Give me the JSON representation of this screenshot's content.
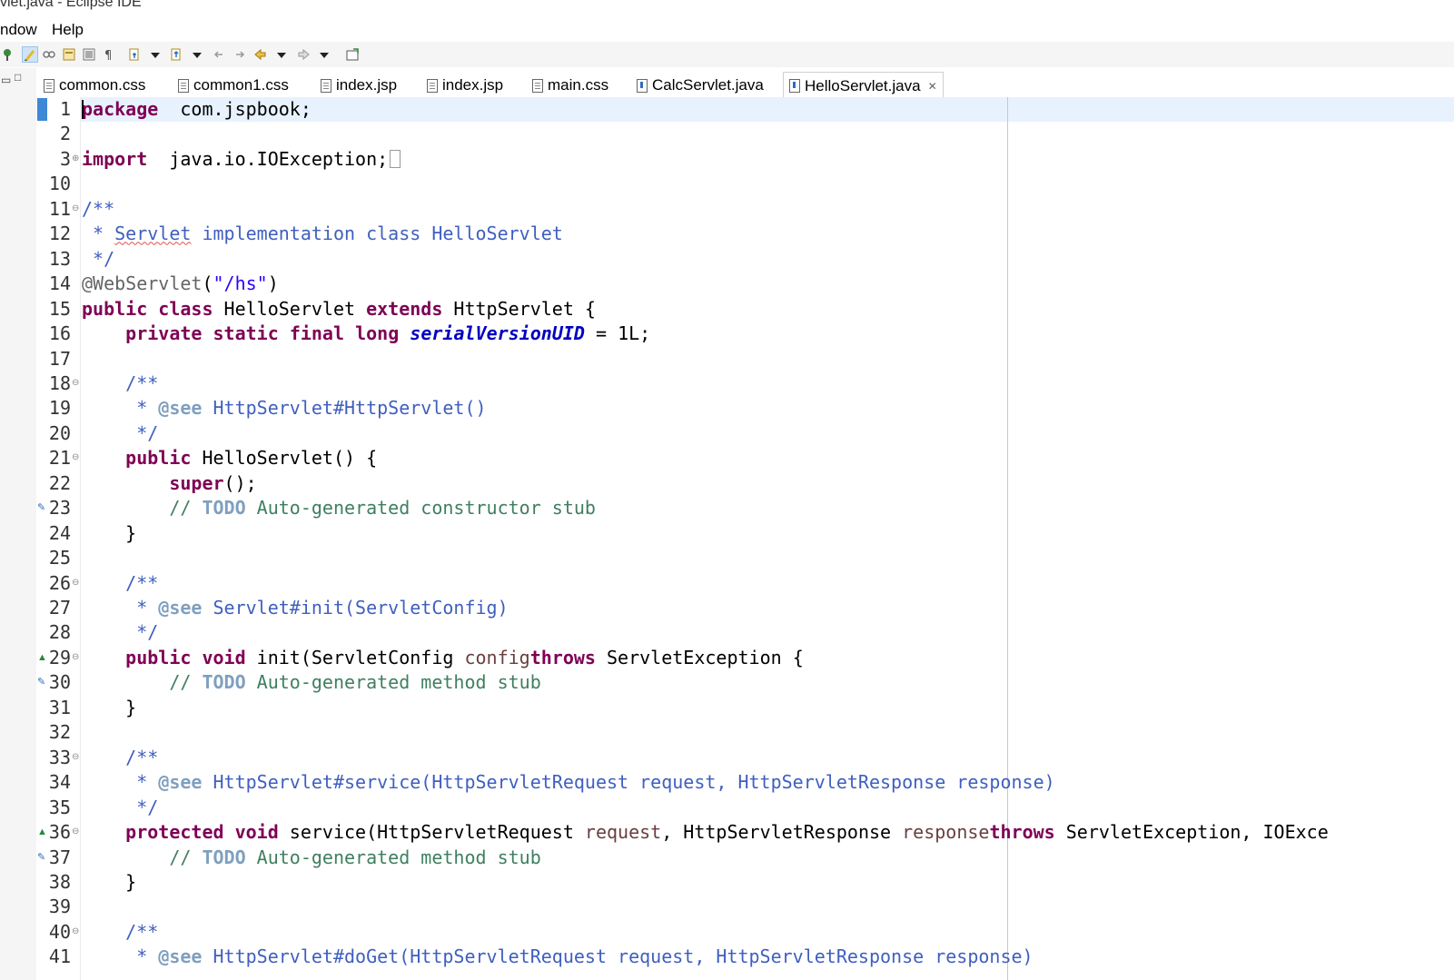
{
  "window": {
    "title": "vlet.java - Eclipse IDE"
  },
  "menu": {
    "items": [
      "ndow",
      "Help"
    ]
  },
  "toolbar": {
    "icons": [
      "pin-icon",
      "highlight-icon",
      "link-icon",
      "annotation-icon",
      "block-icon",
      "pilcrow-icon",
      "next-annotation-icon",
      "dropdown-icon",
      "prev-annotation-icon",
      "dropdown-icon",
      "last-edit-icon",
      "forward-edit-icon",
      "back-icon",
      "dropdown-icon",
      "forward-icon",
      "dropdown-icon",
      "open-perspective-icon"
    ]
  },
  "editor_tabs": [
    {
      "label": "common.css",
      "type": "css",
      "active": false
    },
    {
      "label": "common1.css",
      "type": "css",
      "active": false
    },
    {
      "label": "index.jsp",
      "type": "jsp",
      "active": false
    },
    {
      "label": "index.jsp",
      "type": "jsp",
      "active": false
    },
    {
      "label": "main.css",
      "type": "css",
      "active": false
    },
    {
      "label": "CalcServlet.java",
      "type": "java",
      "active": false
    },
    {
      "label": "HelloServlet.java",
      "type": "java",
      "active": true
    }
  ],
  "code": {
    "lines": [
      {
        "n": "1",
        "tokens": [
          [
            "kw",
            "package"
          ],
          [
            "",
            "  com.jspbook;"
          ]
        ]
      },
      {
        "n": "2",
        "tokens": []
      },
      {
        "n": "3",
        "fold": "⊕",
        "tokens": [
          [
            "kw",
            "import"
          ],
          [
            "",
            "  java.io.IOException;"
          ]
        ],
        "folded": true
      },
      {
        "n": "10",
        "tokens": []
      },
      {
        "n": "11",
        "fold": "⊖",
        "tokens": [
          [
            "cm",
            "/**"
          ]
        ]
      },
      {
        "n": "12",
        "tokens": [
          [
            "cm",
            " * "
          ],
          [
            "cm sq",
            "Servlet"
          ],
          [
            "cm",
            " implementation class HelloServlet"
          ]
        ]
      },
      {
        "n": "13",
        "tokens": [
          [
            "cm",
            " */"
          ]
        ]
      },
      {
        "n": "14",
        "tokens": [
          [
            "an",
            "@WebServlet"
          ],
          [
            "",
            "("
          ],
          [
            "st",
            "\"/hs\""
          ],
          [
            "",
            ")"
          ]
        ]
      },
      {
        "n": "15",
        "tokens": [
          [
            "kw",
            "public"
          ],
          [
            "",
            " "
          ],
          [
            "kw",
            "class"
          ],
          [
            "",
            " HelloServlet "
          ],
          [
            "kw",
            "extends"
          ],
          [
            "",
            " HttpServlet {"
          ]
        ]
      },
      {
        "n": "16",
        "tokens": [
          [
            "",
            "    "
          ],
          [
            "kw",
            "private"
          ],
          [
            "",
            " "
          ],
          [
            "kw",
            "static"
          ],
          [
            "",
            " "
          ],
          [
            "kw",
            "final"
          ],
          [
            "",
            " "
          ],
          [
            "kw",
            "long"
          ],
          [
            "",
            " "
          ],
          [
            "fld",
            "serialVersionUID"
          ],
          [
            "",
            " = 1L;"
          ]
        ]
      },
      {
        "n": "17",
        "tokens": []
      },
      {
        "n": "18",
        "fold": "⊖",
        "tokens": [
          [
            "",
            "    "
          ],
          [
            "cm",
            "/**"
          ]
        ]
      },
      {
        "n": "19",
        "tokens": [
          [
            "cm",
            "     * "
          ],
          [
            "tag",
            "@see"
          ],
          [
            "cm",
            " HttpServlet#HttpServlet()"
          ]
        ]
      },
      {
        "n": "20",
        "tokens": [
          [
            "cm",
            "     */"
          ]
        ]
      },
      {
        "n": "21",
        "fold": "⊖",
        "tokens": [
          [
            "",
            "    "
          ],
          [
            "kw",
            "public"
          ],
          [
            "",
            " HelloServlet() {"
          ]
        ]
      },
      {
        "n": "22",
        "tokens": [
          [
            "",
            "        "
          ],
          [
            "kw",
            "super"
          ],
          [
            "",
            "();"
          ]
        ]
      },
      {
        "n": "23",
        "ann": "task",
        "tokens": [
          [
            "",
            "        "
          ],
          [
            "lc",
            "// "
          ],
          [
            "todo",
            "TODO"
          ],
          [
            "lc",
            " Auto-generated constructor stub"
          ]
        ]
      },
      {
        "n": "24",
        "tokens": [
          [
            "",
            "    }"
          ]
        ]
      },
      {
        "n": "25",
        "tokens": []
      },
      {
        "n": "26",
        "fold": "⊖",
        "tokens": [
          [
            "",
            "    "
          ],
          [
            "cm",
            "/**"
          ]
        ]
      },
      {
        "n": "27",
        "tokens": [
          [
            "cm",
            "     * "
          ],
          [
            "tag",
            "@see"
          ],
          [
            "cm",
            " Servlet#init(ServletConfig)"
          ]
        ]
      },
      {
        "n": "28",
        "tokens": [
          [
            "cm",
            "     */"
          ]
        ]
      },
      {
        "n": "29",
        "fold": "⊖",
        "ann": "override",
        "tokens": [
          [
            "",
            "    "
          ],
          [
            "kw",
            "public"
          ],
          [
            "",
            " "
          ],
          [
            "kw",
            "void"
          ],
          [
            "",
            " init(ServletConfig "
          ],
          [
            "par",
            "config"
          ],
          [
            ") "
          ],
          [
            "kw",
            "throws"
          ],
          [
            "",
            " ServletException {"
          ]
        ]
      },
      {
        "n": "30",
        "ann": "task",
        "tokens": [
          [
            "",
            "        "
          ],
          [
            "lc",
            "// "
          ],
          [
            "todo",
            "TODO"
          ],
          [
            "lc",
            " Auto-generated method stub"
          ]
        ]
      },
      {
        "n": "31",
        "tokens": [
          [
            "",
            "    }"
          ]
        ]
      },
      {
        "n": "32",
        "tokens": []
      },
      {
        "n": "33",
        "fold": "⊖",
        "tokens": [
          [
            "",
            "    "
          ],
          [
            "cm",
            "/**"
          ]
        ]
      },
      {
        "n": "34",
        "tokens": [
          [
            "cm",
            "     * "
          ],
          [
            "tag",
            "@see"
          ],
          [
            "cm",
            " HttpServlet#service(HttpServletRequest request, HttpServletResponse response)"
          ]
        ]
      },
      {
        "n": "35",
        "tokens": [
          [
            "cm",
            "     */"
          ]
        ]
      },
      {
        "n": "36",
        "fold": "⊖",
        "ann": "override",
        "tokens": [
          [
            "",
            "    "
          ],
          [
            "kw",
            "protected"
          ],
          [
            "",
            " "
          ],
          [
            "kw",
            "void"
          ],
          [
            "",
            " service(HttpServletRequest "
          ],
          [
            "par",
            "request"
          ],
          [
            "",
            ", HttpServletResponse "
          ],
          [
            "par",
            "response"
          ],
          [
            ") "
          ],
          [
            "kw",
            "throws"
          ],
          [
            "",
            " ServletException, IOExce"
          ]
        ]
      },
      {
        "n": "37",
        "ann": "task",
        "tokens": [
          [
            "",
            "        "
          ],
          [
            "lc",
            "// "
          ],
          [
            "todo",
            "TODO"
          ],
          [
            "lc",
            " Auto-generated method stub"
          ]
        ]
      },
      {
        "n": "38",
        "tokens": [
          [
            "",
            "    }"
          ]
        ]
      },
      {
        "n": "39",
        "tokens": []
      },
      {
        "n": "40",
        "fold": "⊖",
        "tokens": [
          [
            "",
            "    "
          ],
          [
            "cm",
            "/**"
          ]
        ]
      },
      {
        "n": "41",
        "tokens": [
          [
            "cm",
            "     * "
          ],
          [
            "tag",
            "@see"
          ],
          [
            "cm",
            " HttpServlet#doGet(HttpServletRequest request, HttpServletResponse response)"
          ]
        ]
      }
    ]
  }
}
